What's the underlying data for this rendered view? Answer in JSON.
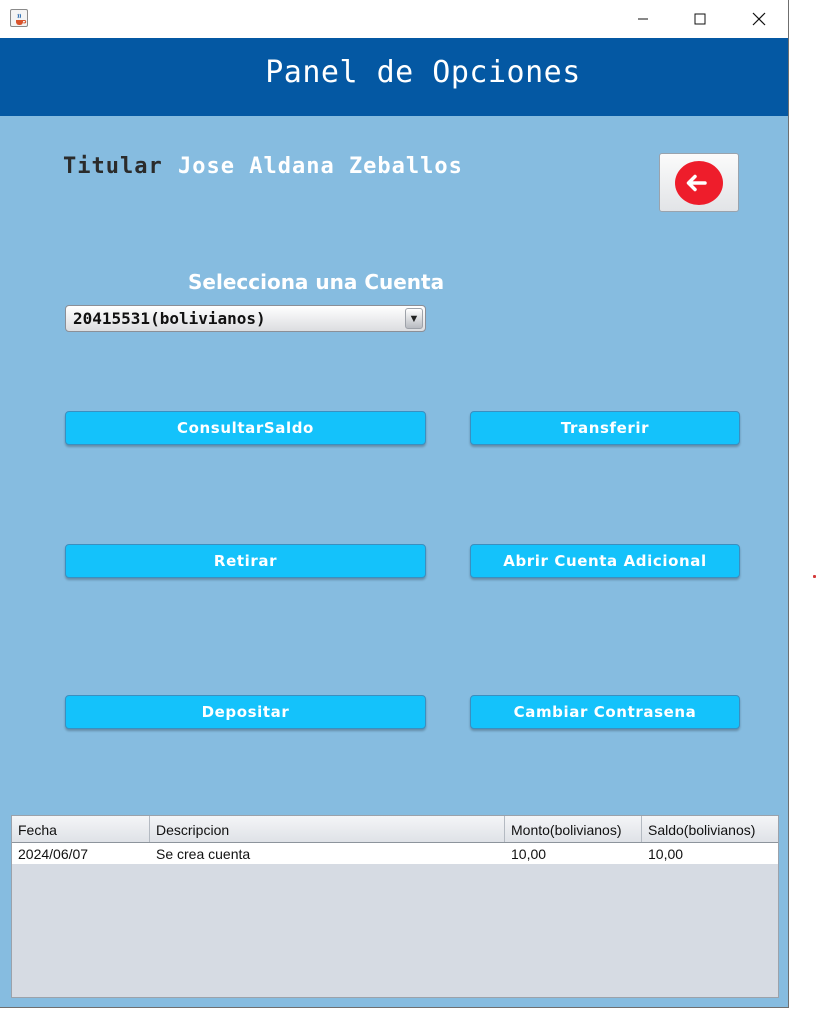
{
  "window": {
    "icon": "java-cup-icon",
    "controls": {
      "minimize": "minimize-icon",
      "maximize": "maximize-icon",
      "close": "close-icon"
    }
  },
  "header": {
    "title": "Panel de Opciones",
    "color": "#0458a3"
  },
  "holder": {
    "label": "Titular",
    "name": "Jose Aldana Zeballos"
  },
  "back_button": {
    "icon": "arrow-left-circle-icon",
    "color": "#ee1d2b"
  },
  "account": {
    "label": "Selecciona una Cuenta",
    "selected": "20415531(bolivianos)"
  },
  "actions": {
    "consultar": "ConsultarSaldo",
    "transferir": "Transferir",
    "retirar": "Retirar",
    "abrir": "Abrir Cuenta Adicional",
    "depositar": "Depositar",
    "cambiar": "Cambiar Contrasena"
  },
  "table": {
    "headers": [
      "Fecha",
      "Descripcion",
      "Monto(bolivianos)",
      "Saldo(bolivianos)"
    ],
    "rows": [
      [
        "2024/06/07",
        "Se crea cuenta",
        "10,00",
        "10,00"
      ]
    ]
  },
  "colors": {
    "background": "#86bce0",
    "button": "#14c2fb",
    "table_bg": "#d6dbe3"
  }
}
